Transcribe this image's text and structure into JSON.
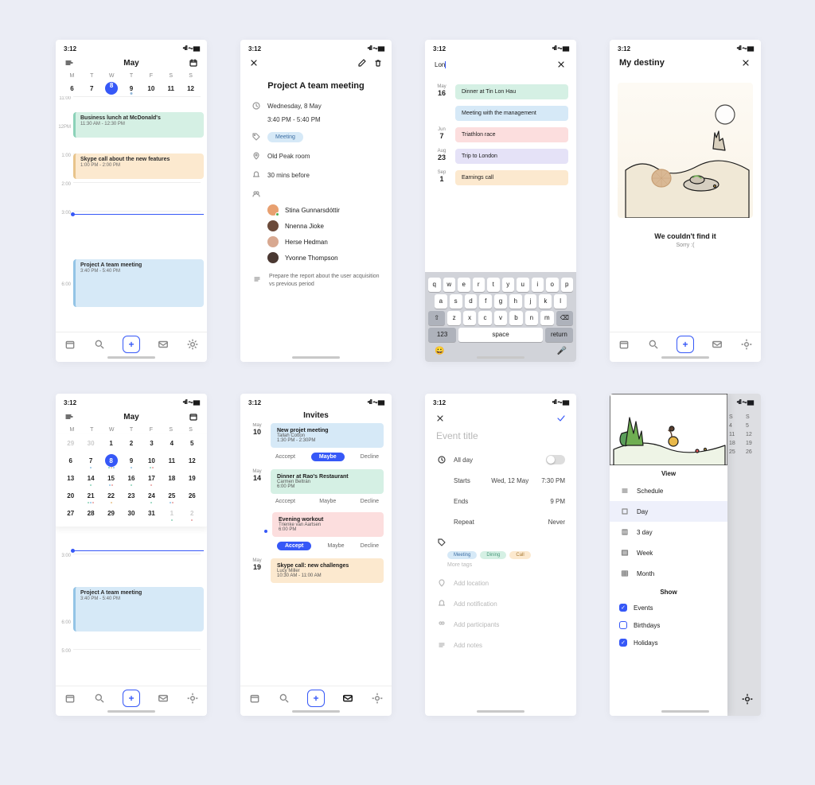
{
  "status_time": "3:12",
  "screen1": {
    "month": "May",
    "weekdays": [
      "M",
      "T",
      "W",
      "T",
      "F",
      "S",
      "S"
    ],
    "dates": [
      "6",
      "7",
      "8",
      "9",
      "10",
      "11",
      "12"
    ],
    "selected_date": "8",
    "slots": [
      "11:00",
      "12PM",
      "1:00",
      "2:00",
      "3:00",
      "",
      "6:00"
    ],
    "events": [
      {
        "title": "Business lunch at McDonald's",
        "time": "11:30 AM - 12:30 PM"
      },
      {
        "title": "Skype call about the new features",
        "time": "1:00 PM - 2:00 PM"
      },
      {
        "title": "Project A team meeting",
        "time": "3:40 PM - 5:40 PM"
      }
    ]
  },
  "screen2": {
    "title": "Project A team meeting",
    "date": "Wednesday, 8 May",
    "time": "3:40 PM - 5:40 PM",
    "tag": "Meeting",
    "location": "Old Peak room",
    "reminder": "30 mins before",
    "attendees": [
      "Stina Gunnarsdóttir",
      "Nnenna Jioke",
      "Herse Hedman",
      "Yvonne Thompson"
    ],
    "note": "Prepare the report about the user acquisition vs previous period"
  },
  "screen3": {
    "query": "Lon",
    "results": [
      {
        "month": "May",
        "day": "16",
        "title": "Dinner at Tin Lon Hau",
        "cls": "ev-mint"
      },
      {
        "month": "",
        "day": "",
        "title": "Meeting with the management",
        "cls": "ev-blue"
      },
      {
        "month": "Jun",
        "day": "7",
        "title": "Triathlon race",
        "cls": "ev-red"
      },
      {
        "month": "Aug",
        "day": "23",
        "title": "Trip to London",
        "cls": "ev-lav"
      },
      {
        "month": "Sep",
        "day": "1",
        "title": "Earnings call",
        "cls": "ev-peach"
      }
    ],
    "keyboard": {
      "r1": [
        "q",
        "w",
        "e",
        "r",
        "t",
        "y",
        "u",
        "i",
        "o",
        "p"
      ],
      "r2": [
        "a",
        "s",
        "d",
        "f",
        "g",
        "h",
        "j",
        "k",
        "l"
      ],
      "r3_shift": "⇧",
      "r3": [
        "z",
        "x",
        "c",
        "v",
        "b",
        "n",
        "m"
      ],
      "r3_del": "⌫",
      "r4_num": "123",
      "r4_space": "space",
      "r4_return": "return"
    }
  },
  "screen4": {
    "title": "My destiny",
    "empty_title": "We couldn't find it",
    "empty_sub": "Sorry :("
  },
  "screen5": {
    "month": "May",
    "weekdays": [
      "M",
      "T",
      "W",
      "T",
      "F",
      "S",
      "S"
    ],
    "grid": [
      [
        "29",
        "30",
        "1",
        "2",
        "3",
        "4",
        "5"
      ],
      [
        "6",
        "7",
        "8",
        "9",
        "10",
        "11",
        "12"
      ],
      [
        "13",
        "14",
        "15",
        "16",
        "17",
        "18",
        "19"
      ],
      [
        "20",
        "21",
        "22",
        "23",
        "24",
        "25",
        "26"
      ],
      [
        "27",
        "28",
        "29",
        "30",
        "31",
        "1",
        "2"
      ]
    ],
    "out_dates": [
      "29",
      "30",
      "1",
      "2"
    ],
    "selected": "8",
    "event": {
      "title": "Project A team meeting",
      "time": "3:40 PM - 5:40 PM"
    },
    "slots": [
      "",
      "3:00",
      "",
      "6:00",
      "5:00"
    ]
  },
  "screen6": {
    "title": "Invites",
    "items": [
      {
        "date_m": "May",
        "date_d": "10",
        "title": "New projet meeting",
        "who": "Tallah Cotton",
        "when": "1:30 PM - 2:30PM",
        "cls": "ev-blue",
        "a": "Acccept",
        "b": "Maybe",
        "c": "Decline",
        "hot": "b"
      },
      {
        "date_m": "May",
        "date_d": "14",
        "title": "Dinner at Rao's Restaurant",
        "who": "Carmen Beltrán",
        "when": "6:00 PM",
        "cls": "ev-mint",
        "a": "Acccept",
        "b": "Maybe",
        "c": "Decline",
        "hot": ""
      },
      {
        "date_m": "",
        "date_d": "",
        "title": "Evening workout",
        "who": "Trienke van Aartsen",
        "when": "6:00 PM",
        "cls": "ev-red",
        "a": "Accept",
        "b": "Maybe",
        "c": "Decline",
        "hot": "a",
        "new": true
      },
      {
        "date_m": "May",
        "date_d": "19",
        "title": "Skype call: new challenges",
        "who": "Lucy Miller",
        "when": "10:30 AM - 11:00 AM",
        "cls": "ev-peach",
        "a": "",
        "b": "",
        "c": "",
        "hot": ""
      }
    ]
  },
  "screen7": {
    "title_placeholder": "Event title",
    "allday": "All day",
    "starts": "Starts",
    "starts_date": "Wed, 12 May",
    "starts_time": "7:30 PM",
    "ends": "Ends",
    "ends_time": "9 PM",
    "repeat": "Repeat",
    "repeat_val": "Never",
    "tags": [
      {
        "label": "Meeting",
        "bg": "#d6e9f7",
        "fg": "#3d6fa3"
      },
      {
        "label": "Dining",
        "bg": "#d5f0e4",
        "fg": "#49987a"
      },
      {
        "label": "Call",
        "bg": "#fce9cf",
        "fg": "#a87c38"
      }
    ],
    "more_tags": "More tags",
    "add_location": "Add location",
    "add_notification": "Add notification",
    "add_participants": "Add participants",
    "add_notes": "Add notes"
  },
  "screen8": {
    "view_title": "View",
    "views": [
      "Schedule",
      "Day",
      "3 day",
      "Week",
      "Month"
    ],
    "active_view": "Day",
    "show_title": "Show",
    "shows": [
      {
        "label": "Events",
        "on": true
      },
      {
        "label": "Birthdays",
        "on": false
      },
      {
        "label": "Holidays",
        "on": true
      }
    ]
  }
}
